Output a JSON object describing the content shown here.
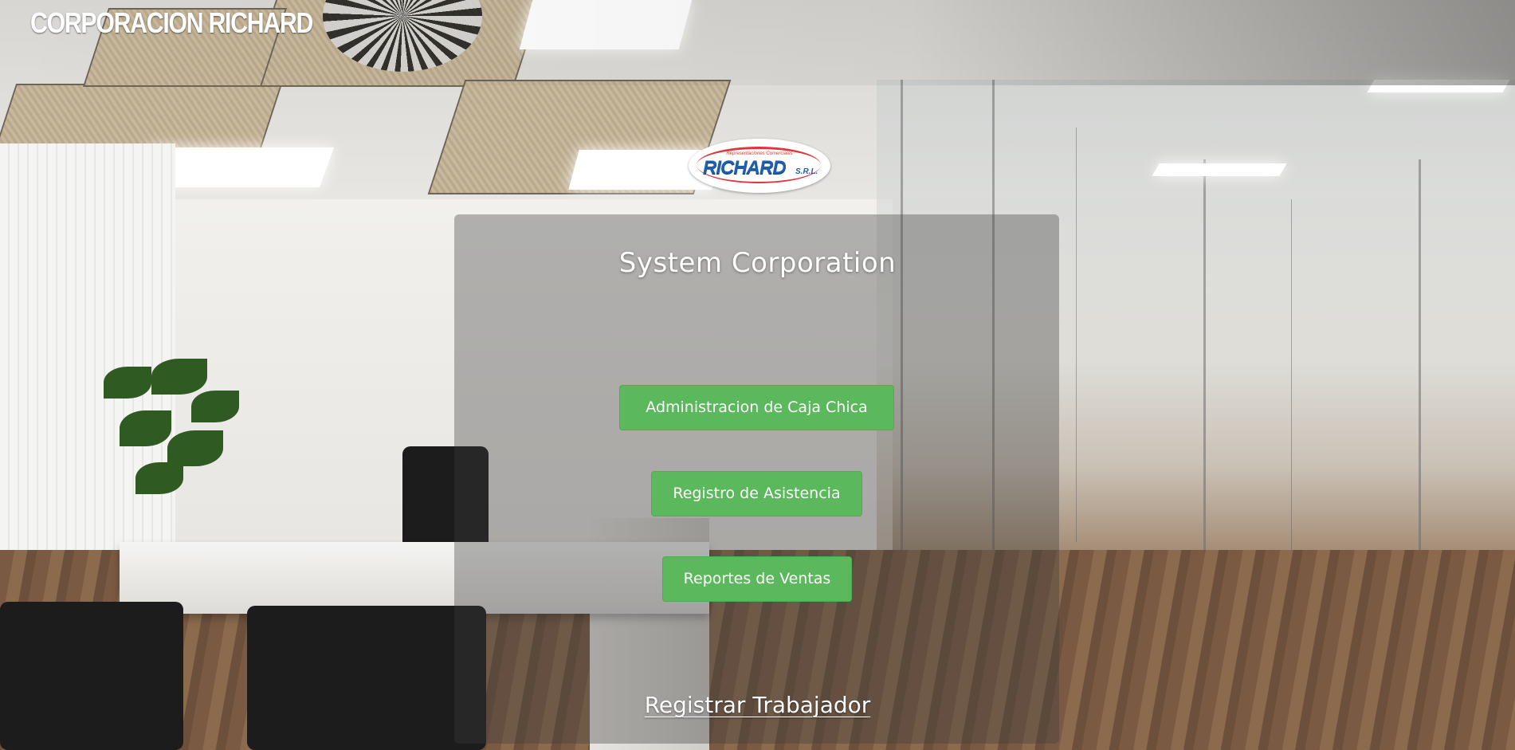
{
  "header": {
    "brand": "CORPORACION RICHARD"
  },
  "logo": {
    "tagline": "Representaciones Comerciales",
    "name": "RICHARD",
    "suffix": "S.R.L."
  },
  "panel": {
    "title": "System Corporation",
    "buttons": [
      {
        "label": "Administracion de Caja Chica"
      },
      {
        "label": "Registro de Asistencia"
      },
      {
        "label": "Reportes de Ventas"
      }
    ],
    "register_link": "Registrar Trabajador"
  },
  "colors": {
    "button_green": "#5cb85c",
    "logo_blue": "#1f5fb0",
    "logo_red": "#e2343a",
    "panel_overlay": "rgba(60,60,60,0.36)"
  }
}
